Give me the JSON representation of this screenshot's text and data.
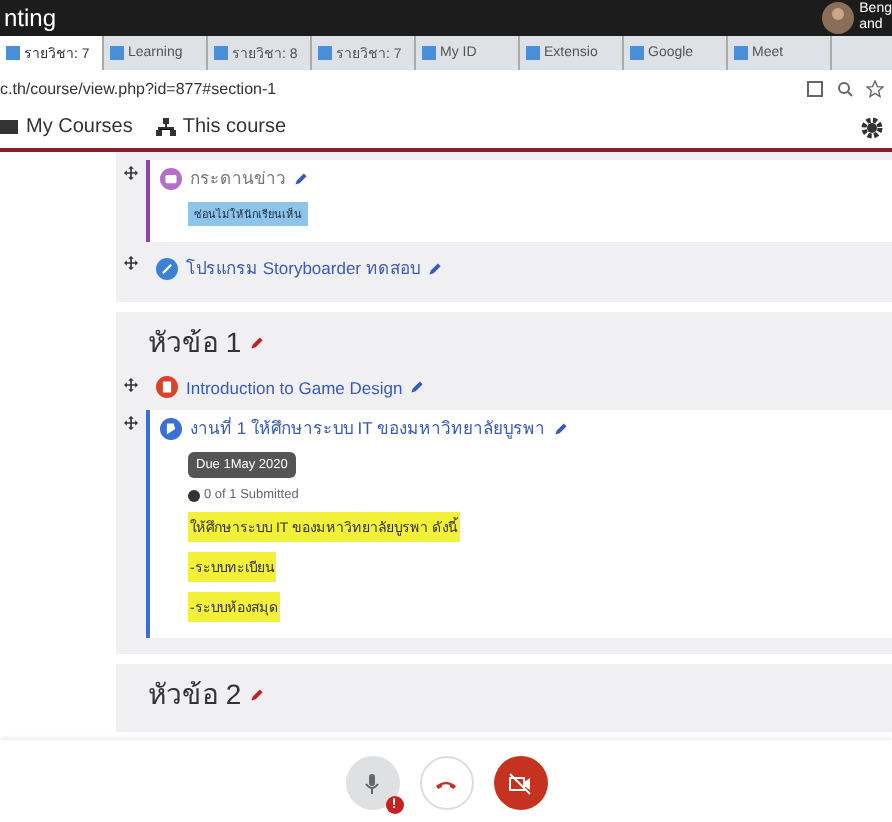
{
  "meet": {
    "status": "nting",
    "participant": [
      "Beng",
      "and"
    ],
    "controls": [
      {
        "kind": "mic",
        "badge": "!"
      },
      {
        "kind": "hangup"
      },
      {
        "kind": "camera",
        "muted": true
      }
    ]
  },
  "browser": {
    "tabs": [
      {
        "label": "รายวิชา: 7",
        "selected": true
      },
      {
        "label": "Learning",
        "selected": false
      },
      {
        "label": "รายวิชา: 8",
        "selected": false
      },
      {
        "label": "รายวิชา: 7",
        "selected": false
      },
      {
        "label": "My ID",
        "selected": false
      },
      {
        "label": "Extensio",
        "selected": false
      },
      {
        "label": "Google",
        "selected": false
      },
      {
        "label": "Meet",
        "selected": false
      }
    ],
    "address": "c.th/course/view.php?id=877#section-1"
  },
  "navbar": {
    "items": [
      "My Courses",
      "This course"
    ]
  },
  "sections": [
    {
      "activities": [
        {
          "kind": "forum",
          "name": "กระดานข่าว",
          "badge": "ซ่อนไม่ให้นักเรียนเห็น"
        },
        {
          "kind": "url",
          "name": "โปรแกรม Storyboarder ทดสอบ"
        }
      ]
    },
    {
      "title": "หัวข้อ 1",
      "activities": [
        {
          "kind": "page",
          "name": "Introduction to Game Design"
        },
        {
          "kind": "assign",
          "name": "งานที่ 1 ให้ศึกษาระบบ IT ของมหาวิทยาลัยบูรพา",
          "due": "Due 1May 2020",
          "submissions": "0 of 1 Submitted",
          "description": [
            "ให้ศึกษาระบบ IT ของมหาวิทยาลัยบูรพา ดังนี้",
            "-ระบบทะเบียน",
            "-ระบบห้องสมุด"
          ]
        }
      ]
    },
    {
      "title": "หัวข้อ 2"
    }
  ]
}
